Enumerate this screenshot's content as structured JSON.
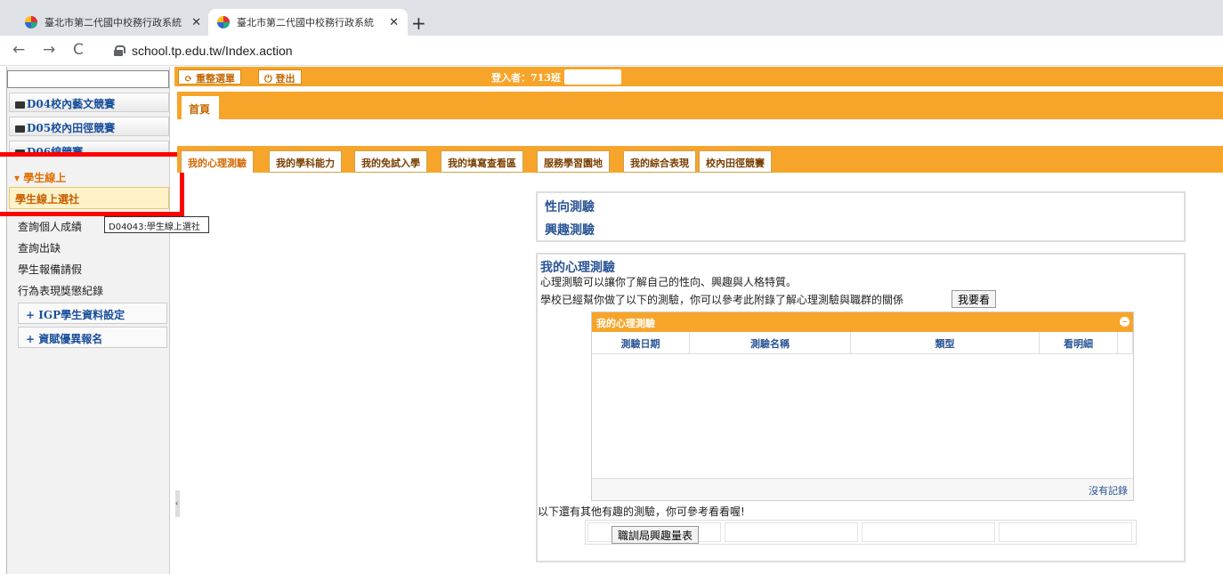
{
  "browser": {
    "tabs": [
      {
        "title": "臺北市第二代國中校務行政系統",
        "close": "✕"
      },
      {
        "title": "臺北市第二代國中校務行政系統",
        "close": "✕"
      }
    ],
    "new_tab": "+",
    "nav": {
      "back": "←",
      "forward": "→",
      "reload": "C"
    },
    "url": "school.tp.edu.tw/Index.action"
  },
  "topbar": {
    "menu_btn": "重整選單",
    "logout_btn": "登出",
    "login_info": "登入者：713班"
  },
  "home_tab": "首頁",
  "sidebar": {
    "groups": [
      "D04校內藝文競賽",
      "D05校內田徑競賽",
      "D06線競賽"
    ],
    "expanded": "學生線上",
    "selected": "學生線上選社",
    "links": [
      "查詢個人成績",
      "查詢出缺",
      "學生報備請假",
      "行為表現獎懲紀錄"
    ],
    "boxes": [
      "IGP學生資料設定",
      "資賦優異報名"
    ],
    "tooltip": "D04043:學生線上選社"
  },
  "page_tabs": [
    "我的心理測驗",
    "我的學科能力",
    "我的免試入學",
    "我的填寫查看區",
    "服務學習園地",
    "我的綜合表現",
    "校內田徑競賽"
  ],
  "panel1": {
    "links": [
      "性向測驗",
      "興趣測驗"
    ]
  },
  "panel2": {
    "title": "我的心理測驗",
    "line1": "心理測驗可以讓你了解自己的性向、興趣與人格特質。",
    "line2": "學校已經幫你做了以下的測驗，你可以參考此附錄了解心理測驗與職群的關係",
    "see_btn": "我要看",
    "grid": {
      "title": "我的心理測驗",
      "columns": [
        "測驗日期",
        "測驗名稱",
        "類型",
        "看明細"
      ],
      "empty": "沒有記錄"
    },
    "more_text": "以下還有其他有趣的測驗，你可參考看看喔!",
    "voc_btn": "職訓局興趣量表"
  }
}
